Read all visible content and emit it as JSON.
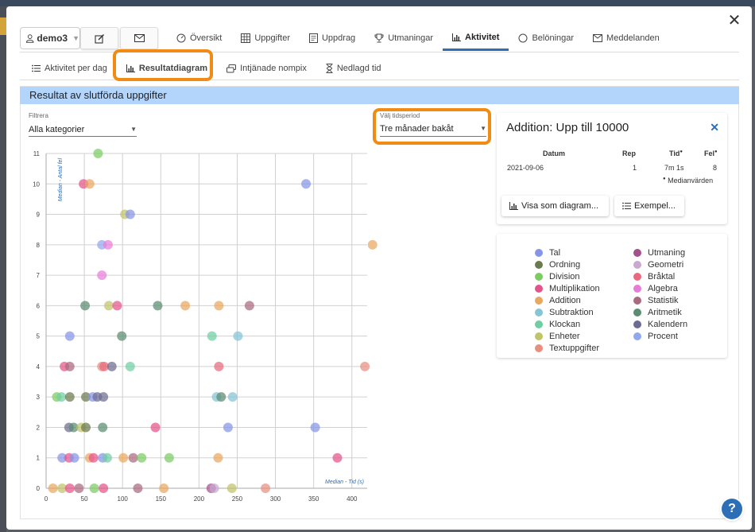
{
  "header": {
    "user": "demo3",
    "tabs": [
      {
        "label": "Översikt",
        "icon": "gauge-icon"
      },
      {
        "label": "Uppgifter",
        "icon": "grid-icon"
      },
      {
        "label": "Uppdrag",
        "icon": "document-icon"
      },
      {
        "label": "Utmaningar",
        "icon": "trophy-icon"
      },
      {
        "label": "Aktivitet",
        "icon": "bar-chart-icon",
        "active": true
      },
      {
        "label": "Belöningar",
        "icon": "circle-icon"
      },
      {
        "label": "Meddelanden",
        "icon": "envelope-icon"
      }
    ]
  },
  "subtabs": [
    {
      "label": "Aktivitet per dag",
      "icon": "list-icon"
    },
    {
      "label": "Resultatdiagram",
      "icon": "bar-chart-icon",
      "active": true
    },
    {
      "label": "Intjänade nompix",
      "icon": "coins-icon"
    },
    {
      "label": "Nedlagd tid",
      "icon": "hourglass-icon"
    }
  ],
  "section_title": "Resultat av slutförda uppgifter",
  "filter": {
    "label": "Filtrera",
    "value": "Alla kategorier"
  },
  "period": {
    "label": "Välj tidsperiod",
    "value": "Tre månader bakåt"
  },
  "detail": {
    "title": "Addition: Upp till 10000",
    "headers": {
      "date": "Datum",
      "rep": "Rep",
      "time": "Tid",
      "errors": "Fel"
    },
    "row": {
      "date": "2021-09-06",
      "rep": "1",
      "time": "7m 1s",
      "errors": "8"
    },
    "footnote": "Medianvärden",
    "show_chart_button": "Visa som diagram...",
    "examples_button": "Exempel..."
  },
  "colors": {
    "accent": "#2c6fb7",
    "highlight": "#f08c14",
    "section_bar": "#b3d4fb"
  },
  "legend": [
    {
      "name": "Tal",
      "color": "#8795e8"
    },
    {
      "name": "Ordning",
      "color": "#6b7a4f"
    },
    {
      "name": "Division",
      "color": "#7ccc62"
    },
    {
      "name": "Multiplikation",
      "color": "#e4538a"
    },
    {
      "name": "Addition",
      "color": "#e9a860"
    },
    {
      "name": "Subtraktion",
      "color": "#84c5d6"
    },
    {
      "name": "Klockan",
      "color": "#6fcfa2"
    },
    {
      "name": "Enheter",
      "color": "#c2c46a"
    },
    {
      "name": "Textuppgifter",
      "color": "#e88f80"
    },
    {
      "name": "Utmaning",
      "color": "#a54f8e"
    },
    {
      "name": "Geometri",
      "color": "#c9a9cf"
    },
    {
      "name": "Bråktal",
      "color": "#e96a7e"
    },
    {
      "name": "Algebra",
      "color": "#e77ddb"
    },
    {
      "name": "Statistik",
      "color": "#aa6a7e"
    },
    {
      "name": "Aritmetik",
      "color": "#5c8c72"
    },
    {
      "name": "Kalendern",
      "color": "#6c6c92"
    },
    {
      "name": "Procent",
      "color": "#92a8ee"
    }
  ],
  "chart_data": {
    "type": "scatter",
    "xlabel": "Median - Tid (s)",
    "ylabel": "Median - Antal fel",
    "xlim": [
      0,
      420
    ],
    "ylim": [
      0,
      11
    ],
    "xticks": [
      0,
      50,
      100,
      150,
      200,
      250,
      300,
      350,
      400
    ],
    "yticks": [
      0,
      1,
      2,
      3,
      4,
      5,
      6,
      7,
      8,
      9,
      10,
      11
    ],
    "grid": true,
    "points": [
      {
        "x": 68,
        "y": 11,
        "c": "#7ccc62"
      },
      {
        "x": 49,
        "y": 10,
        "c": "#e4538a"
      },
      {
        "x": 57,
        "y": 10,
        "c": "#e9a860"
      },
      {
        "x": 340,
        "y": 10,
        "c": "#8795e8"
      },
      {
        "x": 103,
        "y": 9,
        "c": "#c2c46a"
      },
      {
        "x": 110,
        "y": 9,
        "c": "#8795e8"
      },
      {
        "x": 73,
        "y": 8,
        "c": "#92a8ee"
      },
      {
        "x": 81,
        "y": 8,
        "c": "#e77ddb"
      },
      {
        "x": 427,
        "y": 8,
        "c": "#e9a860"
      },
      {
        "x": 73,
        "y": 7,
        "c": "#e77ddb"
      },
      {
        "x": 51,
        "y": 6,
        "c": "#5c8c72"
      },
      {
        "x": 82,
        "y": 6,
        "c": "#c2c46a"
      },
      {
        "x": 93,
        "y": 6,
        "c": "#e4538a"
      },
      {
        "x": 146,
        "y": 6,
        "c": "#5c8c72"
      },
      {
        "x": 182,
        "y": 6,
        "c": "#e9a860"
      },
      {
        "x": 226,
        "y": 6,
        "c": "#e9a860"
      },
      {
        "x": 266,
        "y": 6,
        "c": "#aa6a7e"
      },
      {
        "x": 31,
        "y": 5,
        "c": "#8795e8"
      },
      {
        "x": 99,
        "y": 5,
        "c": "#5c8c72"
      },
      {
        "x": 217,
        "y": 5,
        "c": "#6fcfa2"
      },
      {
        "x": 251,
        "y": 5,
        "c": "#84c5d6"
      },
      {
        "x": 24,
        "y": 4,
        "c": "#e4538a"
      },
      {
        "x": 31,
        "y": 4,
        "c": "#aa6a7e"
      },
      {
        "x": 73,
        "y": 4,
        "c": "#e88f80"
      },
      {
        "x": 76,
        "y": 4,
        "c": "#e96a7e"
      },
      {
        "x": 86,
        "y": 4,
        "c": "#6c6c92"
      },
      {
        "x": 110,
        "y": 4,
        "c": "#6fcfa2"
      },
      {
        "x": 226,
        "y": 4,
        "c": "#e96a7e"
      },
      {
        "x": 417,
        "y": 4,
        "c": "#e88f80"
      },
      {
        "x": 14,
        "y": 3,
        "c": "#7ccc62"
      },
      {
        "x": 20,
        "y": 3,
        "c": "#6fcfa2"
      },
      {
        "x": 31,
        "y": 3,
        "c": "#6b7a4f"
      },
      {
        "x": 52,
        "y": 3,
        "c": "#6b7a4f"
      },
      {
        "x": 61,
        "y": 3,
        "c": "#8795e8"
      },
      {
        "x": 67,
        "y": 3,
        "c": "#6c6c92"
      },
      {
        "x": 75,
        "y": 3,
        "c": "#6c6c92"
      },
      {
        "x": 223,
        "y": 3,
        "c": "#84c5d6"
      },
      {
        "x": 229,
        "y": 3,
        "c": "#5c8c72"
      },
      {
        "x": 244,
        "y": 3,
        "c": "#84c5d6"
      },
      {
        "x": 30,
        "y": 2,
        "c": "#6c6c92"
      },
      {
        "x": 36,
        "y": 2,
        "c": "#5c8c72"
      },
      {
        "x": 46,
        "y": 2,
        "c": "#c2c46a"
      },
      {
        "x": 52,
        "y": 2,
        "c": "#6b7a4f"
      },
      {
        "x": 74,
        "y": 2,
        "c": "#5c8c72"
      },
      {
        "x": 143,
        "y": 2,
        "c": "#e4538a"
      },
      {
        "x": 238,
        "y": 2,
        "c": "#8795e8"
      },
      {
        "x": 352,
        "y": 2,
        "c": "#8795e8"
      },
      {
        "x": 21,
        "y": 1,
        "c": "#8795e8"
      },
      {
        "x": 30,
        "y": 1,
        "c": "#e4538a"
      },
      {
        "x": 37,
        "y": 1,
        "c": "#8795e8"
      },
      {
        "x": 57,
        "y": 1,
        "c": "#e9a860"
      },
      {
        "x": 62,
        "y": 1,
        "c": "#e4538a"
      },
      {
        "x": 74,
        "y": 1,
        "c": "#8795e8"
      },
      {
        "x": 80,
        "y": 1,
        "c": "#6fcfa2"
      },
      {
        "x": 101,
        "y": 1,
        "c": "#e9a860"
      },
      {
        "x": 114,
        "y": 1,
        "c": "#aa6a7e"
      },
      {
        "x": 125,
        "y": 1,
        "c": "#7ccc62"
      },
      {
        "x": 161,
        "y": 1,
        "c": "#7ccc62"
      },
      {
        "x": 225,
        "y": 1,
        "c": "#e9a860"
      },
      {
        "x": 381,
        "y": 1,
        "c": "#e4538a"
      },
      {
        "x": 9,
        "y": 0,
        "c": "#e9a860"
      },
      {
        "x": 21,
        "y": 0,
        "c": "#c2c46a"
      },
      {
        "x": 31,
        "y": 0,
        "c": "#e4538a"
      },
      {
        "x": 43,
        "y": 0,
        "c": "#aa6a7e"
      },
      {
        "x": 63,
        "y": 0,
        "c": "#7ccc62"
      },
      {
        "x": 75,
        "y": 0,
        "c": "#e4538a"
      },
      {
        "x": 120,
        "y": 0,
        "c": "#aa6a7e"
      },
      {
        "x": 154,
        "y": 0,
        "c": "#e9a860"
      },
      {
        "x": 216,
        "y": 0,
        "c": "#a54f8e"
      },
      {
        "x": 220,
        "y": 0,
        "c": "#c9a9cf"
      },
      {
        "x": 243,
        "y": 0,
        "c": "#c2c46a"
      },
      {
        "x": 287,
        "y": 0,
        "c": "#e88f80"
      }
    ]
  }
}
